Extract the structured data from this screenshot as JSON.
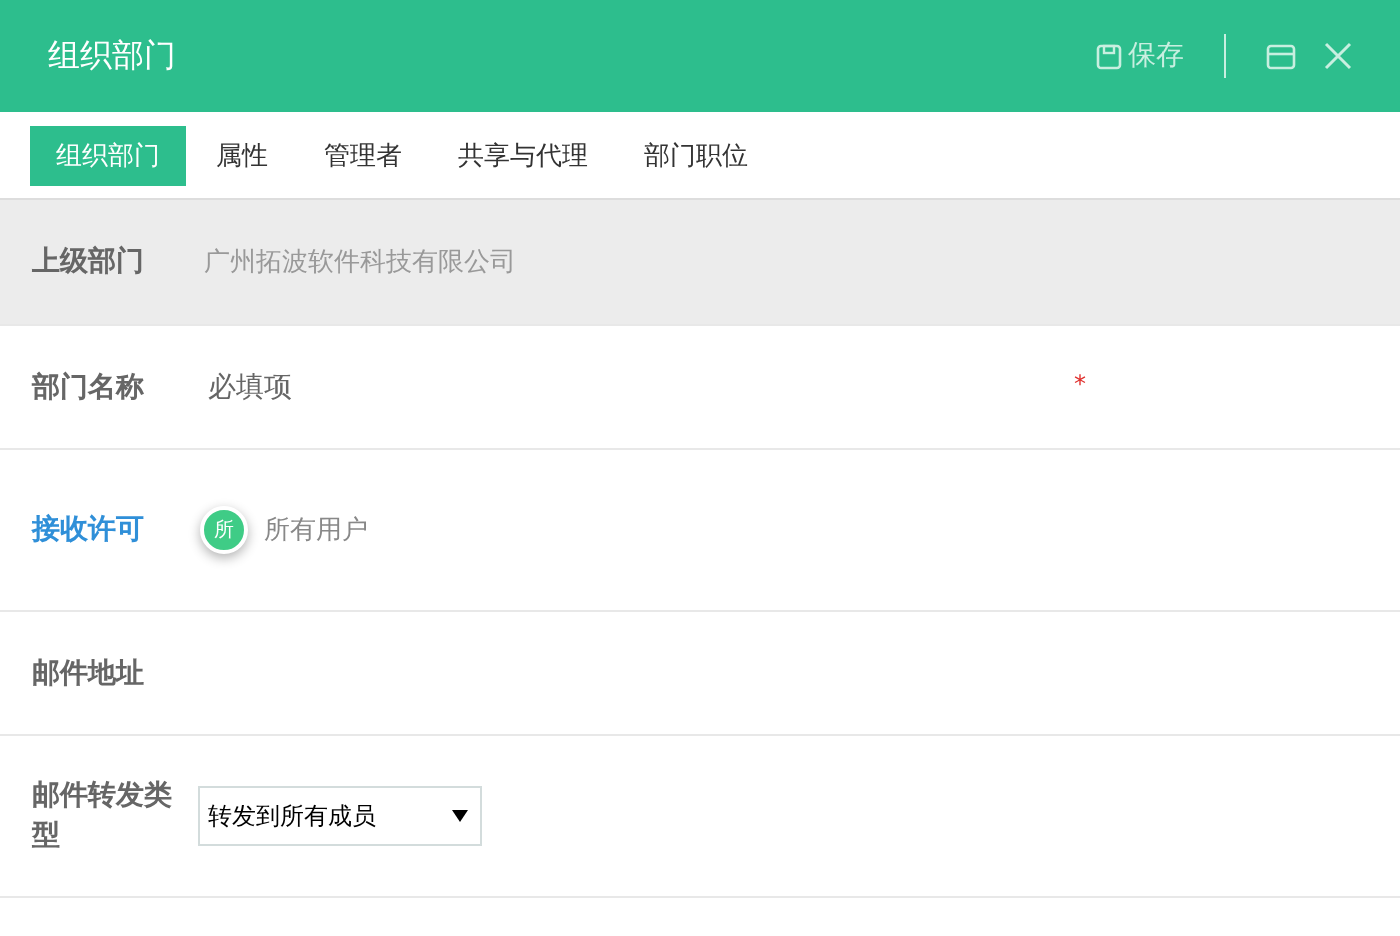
{
  "window": {
    "title": "组织部门",
    "save": "保存"
  },
  "tabs": [
    {
      "label": "组织部门",
      "selected": true
    },
    {
      "label": "属性",
      "selected": false
    },
    {
      "label": "管理者",
      "selected": false
    },
    {
      "label": "共享与代理",
      "selected": false
    },
    {
      "label": "部门职位",
      "selected": false
    }
  ],
  "fields": [
    {
      "kind": "readonly",
      "label": "上级部门",
      "value": "广州拓波软件科技有限公司"
    },
    {
      "kind": "input",
      "label": "部门名称",
      "placeholder": "必填项",
      "required": true,
      "required_mark": "*"
    },
    {
      "kind": "users",
      "label": "接收许可",
      "link": true,
      "chip": "所",
      "value": "所有用户"
    },
    {
      "kind": "empty",
      "label": "邮件地址"
    },
    {
      "kind": "select",
      "label": "邮件转发类型",
      "value": "转发到所有成员"
    }
  ]
}
